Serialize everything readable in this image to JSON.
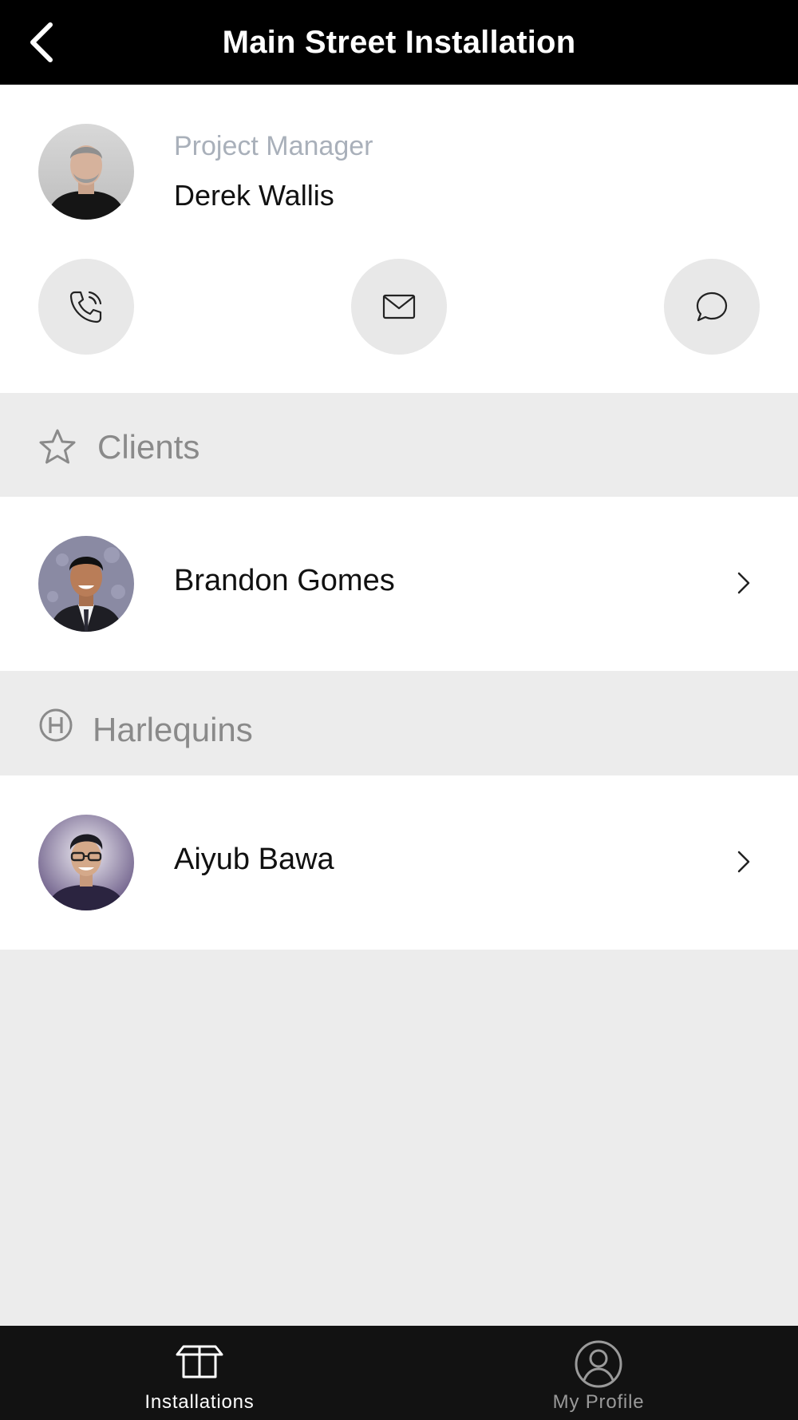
{
  "header": {
    "title": "Main Street Installation",
    "back_icon": "chevron-left-icon"
  },
  "manager": {
    "role": "Project Manager",
    "name": "Derek Wallis",
    "actions": [
      {
        "id": "call",
        "icon": "phone-icon"
      },
      {
        "id": "email",
        "icon": "mail-icon"
      },
      {
        "id": "message",
        "icon": "chat-bubble-icon"
      }
    ]
  },
  "sections": [
    {
      "title": "Clients",
      "icon": "star-icon",
      "contacts": [
        {
          "name": "Brandon Gomes"
        }
      ]
    },
    {
      "title": "Harlequins",
      "icon": "letter-h-circle-icon",
      "contacts": [
        {
          "name": "Aiyub Bawa"
        }
      ]
    }
  ],
  "tabbar": {
    "tabs": [
      {
        "label": "Installations",
        "icon": "box-icon",
        "active": true
      },
      {
        "label": "My Profile",
        "icon": "user-circle-icon",
        "active": false
      }
    ]
  },
  "colors": {
    "header_bg": "#000000",
    "tabbar_bg": "#121212",
    "section_bg": "#ececec",
    "role_label": "#a9b0ba",
    "section_title": "#8a8a8a"
  }
}
